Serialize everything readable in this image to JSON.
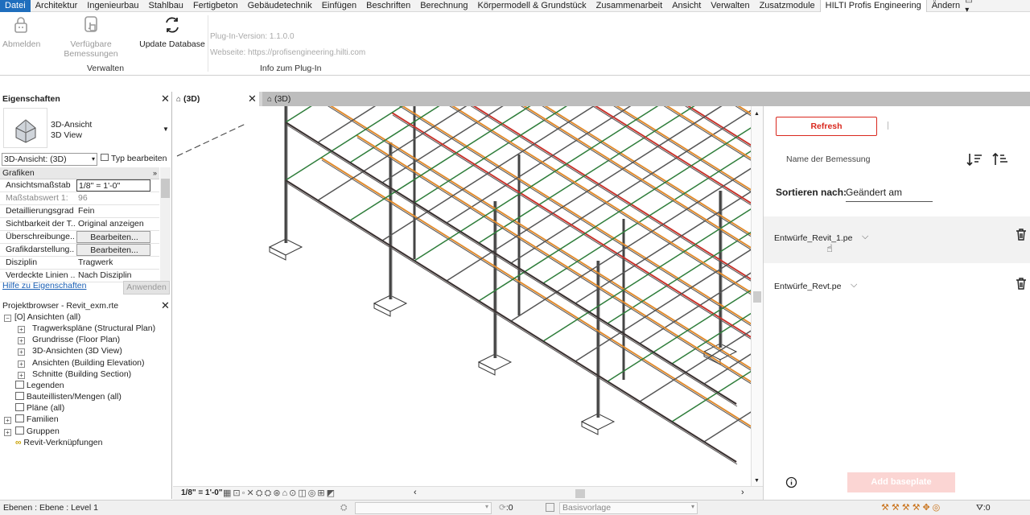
{
  "ribbon_tabs": [
    "Datei",
    "Architektur",
    "Ingenieurbau",
    "Stahlbau",
    "Fertigbeton",
    "Gebäudetechnik",
    "Einfügen",
    "Beschriften",
    "Berechnung",
    "Körpermodell & Grundstück",
    "Zusammenarbeit",
    "Ansicht",
    "Verwalten",
    "Zusatzmodule",
    "HILTI Profis Engineering",
    "Ändern"
  ],
  "ribbon": {
    "logout_label": "Abmelden",
    "available_label": "Verfügbare Bemessungen",
    "update_label": "Update Database",
    "group_manage": "Verwalten",
    "group_info": "Info zum Plug-In",
    "plugin_version": "Plug-In-Version: 1.1.0.0",
    "website": "Webseite: https://profisengineering.hilti.com"
  },
  "properties": {
    "title": "Eigenschaften",
    "type_line1": "3D-Ansicht",
    "type_line2": "3D View",
    "selector": "3D-Ansicht: (3D)",
    "edit_type": "Typ bearbeiten",
    "section": "Grafiken",
    "rows": [
      {
        "k": "Ansichtsmaßstab",
        "v": "1/8\" = 1'-0\""
      },
      {
        "k": "Maßstabswert 1:",
        "v": "96"
      },
      {
        "k": "Detaillierungsgrad",
        "v": "Fein"
      },
      {
        "k": "Sichtbarkeit der T...",
        "v": "Original anzeigen"
      },
      {
        "k": "Überschreibunge...",
        "v": "Bearbeiten..."
      },
      {
        "k": "Grafikdarstellung...",
        "v": "Bearbeiten..."
      },
      {
        "k": "Disziplin",
        "v": "Tragwerk"
      },
      {
        "k": "Verdeckte Linien ...",
        "v": "Nach Disziplin"
      }
    ],
    "help_link": "Hilfe zu Eigenschaften",
    "apply": "Anwenden"
  },
  "browser": {
    "title": "Projektbrowser - Revit_exm.rte",
    "root": "Ansichten (all)",
    "children": [
      "Tragwerkspläne (Structural Plan)",
      "Grundrisse (Floor Plan)",
      "3D-Ansichten (3D View)",
      "Ansichten (Building Elevation)",
      "Schnitte (Building Section)"
    ],
    "others": [
      "Legenden",
      "Bauteillisten/Mengen (all)",
      "Pläne (all)",
      "Familien",
      "Gruppen",
      "Revit-Verknüpfungen"
    ]
  },
  "view_tabs": [
    "(3D)",
    "(3D)"
  ],
  "view_scale": "1/8\" = 1'-0\"",
  "plugin": {
    "refresh": "Refresh",
    "name_label": "Name der Bemessung",
    "sort_label": "Sortieren nach:",
    "sort_value": "Geändert am",
    "entries": [
      "Entwürfe_Revit_1.pe",
      "Entwürfe_Revt.pe"
    ],
    "add_baseplate": "Add baseplate"
  },
  "status": {
    "level": "Ebenen : Ebene : Level 1",
    "zero": ":0",
    "template": "Basisvorlage",
    "filter_count": ":0"
  },
  "colors": {
    "accent": "#1f6ebd",
    "hilti_red": "#d9281e",
    "beam_orange": "#e08a2c",
    "beam_red": "#c8322a",
    "beam_green": "#2e7d3a"
  }
}
